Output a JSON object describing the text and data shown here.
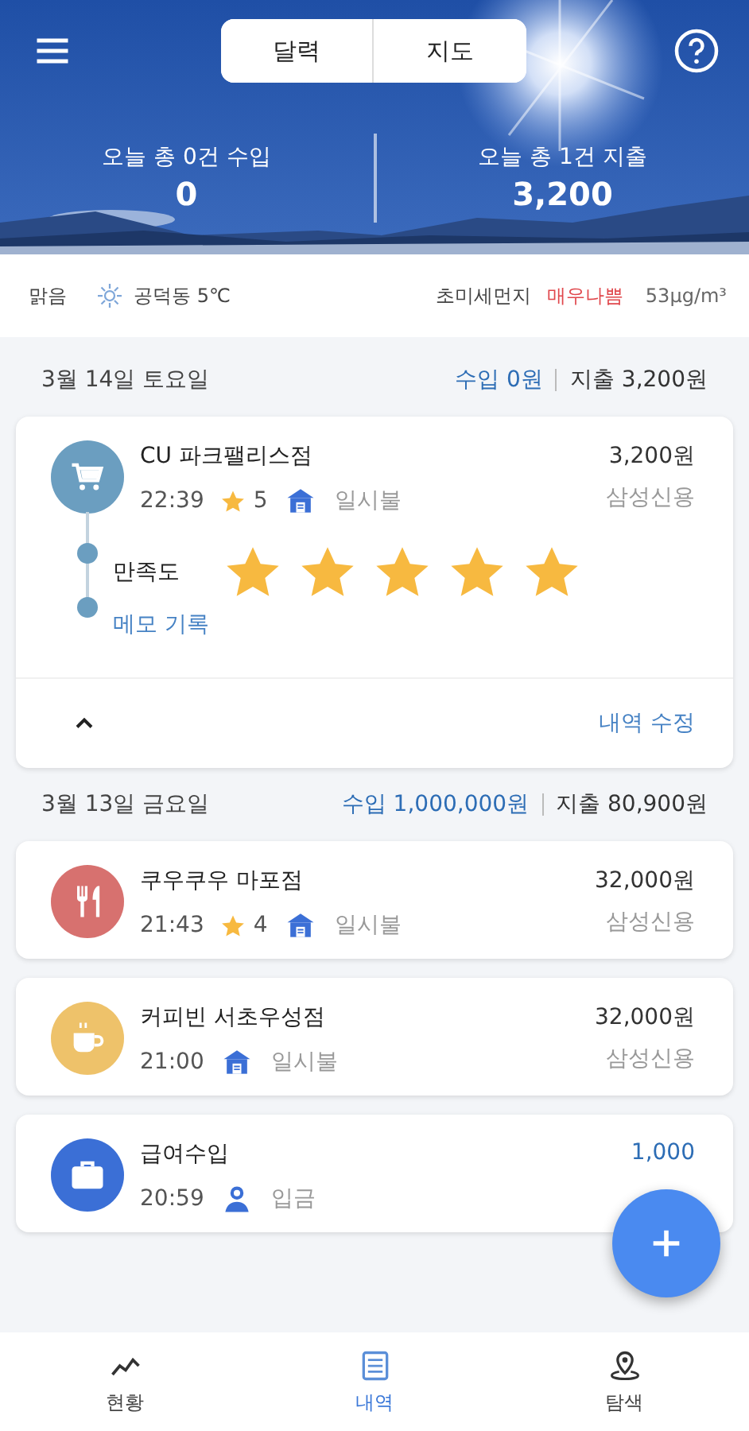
{
  "header": {
    "segments": [
      {
        "label": "달력"
      },
      {
        "label": "지도"
      }
    ],
    "stats": [
      {
        "label": "오늘 총 0건 수입",
        "value": "0"
      },
      {
        "label": "오늘 총 1건 지출",
        "value": "3,200"
      }
    ]
  },
  "weather": {
    "condition": "맑음",
    "location_temp": "공덕동 5℃",
    "dust_label": "초미세먼지",
    "dust_level": "매우나쁨",
    "dust_value": "53μg/m³"
  },
  "days": [
    {
      "date": "3월 14일 토요일",
      "income": "수입 0원",
      "expense": "지출 3,200원",
      "items": [
        {
          "kind": "shopping",
          "color": "#6b9ec0",
          "name": "CU 파크팰리스점",
          "time": "22:39",
          "rating": "5",
          "payment": {
            "kind": "card",
            "label": "일시불"
          },
          "amount": {
            "kind": "expense",
            "text": "3,200원"
          },
          "account": "삼성신용",
          "detail": {
            "label": "만족도",
            "stars": 5,
            "memo": "메모 기록",
            "edit": "내역 수정"
          }
        }
      ]
    },
    {
      "date": "3월 13일 금요일",
      "income": "수입 1,000,000원",
      "expense": "지출 80,900원",
      "items": [
        {
          "kind": "food",
          "color": "#d7716f",
          "name": "쿠우쿠우 마포점",
          "time": "21:43",
          "rating": "4",
          "payment": {
            "kind": "card",
            "label": "일시불"
          },
          "amount": {
            "kind": "expense",
            "text": "32,000원"
          },
          "account": "삼성신용"
        },
        {
          "kind": "cafe",
          "color": "#eec26a",
          "name": "커피빈 서초우성점",
          "time": "21:00",
          "payment": {
            "kind": "card",
            "label": "일시불"
          },
          "amount": {
            "kind": "expense",
            "text": "32,000원"
          },
          "account": "삼성신용"
        },
        {
          "kind": "salary",
          "color": "#3b6fd6",
          "name": "급여수입",
          "time": "20:59",
          "payment": {
            "kind": "deposit",
            "label": "입금"
          },
          "amount": {
            "kind": "income",
            "text": "1,000"
          }
        }
      ]
    }
  ],
  "bottom_nav": [
    {
      "label": "현황",
      "kind": "chart",
      "selected": false
    },
    {
      "label": "내역",
      "kind": "list",
      "selected": true
    },
    {
      "label": "탐색",
      "kind": "explore",
      "selected": false
    }
  ]
}
